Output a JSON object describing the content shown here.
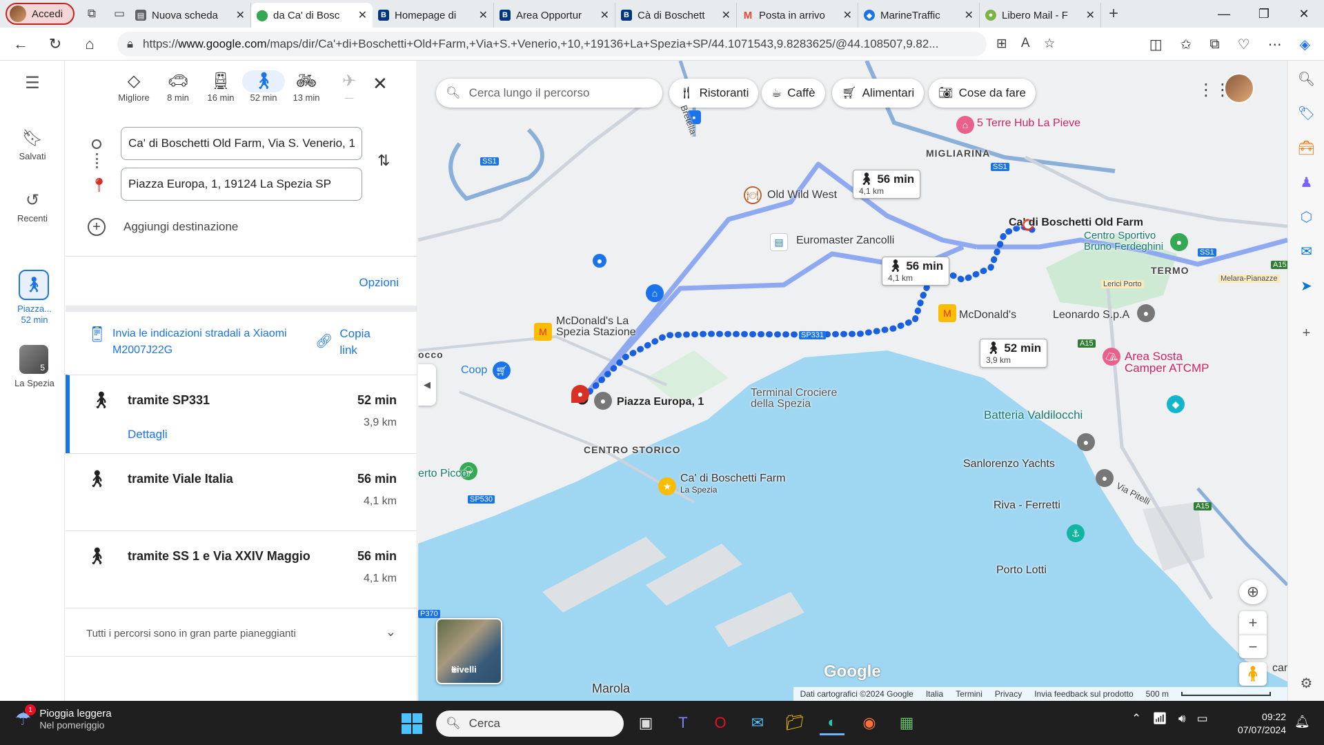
{
  "browser": {
    "profile_label": "Accedi",
    "tabs": [
      {
        "title": "Nuova scheda",
        "favicon": "newtab-icon",
        "color": "#5f6368"
      },
      {
        "title": "da Ca' di Bosc",
        "favicon": "maps-pin-icon",
        "color": "#34a853"
      },
      {
        "title": "Homepage di",
        "favicon": "booking-icon",
        "color": "#003580"
      },
      {
        "title": "Area Opportur",
        "favicon": "booking-icon",
        "color": "#003580"
      },
      {
        "title": "Cà di Boschett",
        "favicon": "booking-icon",
        "color": "#003580"
      },
      {
        "title": "Posta in arrivo",
        "favicon": "gmail-icon",
        "color": "#ea4335"
      },
      {
        "title": "MarineTraffic",
        "favicon": "marinetraffic-icon",
        "color": "#1a73e8"
      },
      {
        "title": "Libero Mail - F",
        "favicon": "libero-icon",
        "color": "#7cb342"
      }
    ],
    "url_prefix": "https://",
    "url_domain": "www.google.com",
    "url_rest": "/maps/dir/Ca'+di+Boschetti+Old+Farm,+Via+S.+Venerio,+10,+19136+La+Spezia+SP/44.1071543,9.8283625/@44.108507,9.82..."
  },
  "rail": {
    "saved": "Salvati",
    "recent": "Recenti",
    "walk_label_1": "Piazza...",
    "walk_label_2": "52 min",
    "thumb_badge": "5",
    "thumb_label": "La Spezia"
  },
  "directions": {
    "modes": [
      {
        "label": "Migliore",
        "icon": "diamond-route-icon"
      },
      {
        "label": "8 min",
        "icon": "car-icon"
      },
      {
        "label": "16 min",
        "icon": "train-icon"
      },
      {
        "label": "52 min",
        "icon": "walk-icon"
      },
      {
        "label": "13 min",
        "icon": "bike-icon"
      },
      {
        "label": "—",
        "icon": "plane-icon"
      }
    ],
    "origin": "Ca' di Boschetti Old Farm, Via S. Venerio, 1",
    "destination": "Piazza Europa, 1, 19124 La Spezia SP",
    "add_destination": "Aggiungi destinazione",
    "options": "Opzioni",
    "send_text": "Invia le indicazioni stradali a Xiaomi M2007J22G",
    "copy_link": "Copia link",
    "routes": [
      {
        "name": "tramite SP331",
        "time": "52 min",
        "distance": "3,9 km",
        "details": "Dettagli"
      },
      {
        "name": "tramite Viale Italia",
        "time": "56 min",
        "distance": "4,1 km"
      },
      {
        "name": "tramite SS 1 e Via XXIV Maggio",
        "time": "56 min",
        "distance": "4,1 km"
      }
    ],
    "footer": "Tutti i percorsi sono in gran parte pianeggianti"
  },
  "map": {
    "search_placeholder": "Cerca lungo il percorso",
    "chips": [
      "Ristoranti",
      "Caffè",
      "Alimentari",
      "Cose da fare"
    ],
    "labels": {
      "hub": "5 Terre Hub La Pieve",
      "migliarina": "MIGLIARINA",
      "old_wild_west": "Old Wild West",
      "euromaster": "Euromaster Zancolli",
      "origin": "Ca' di Boschetti Old Farm",
      "centro_ferdeghini_1": "Centro Sportivo",
      "centro_ferdeghini_2": "Bruno Ferdeghini",
      "termo": "TERMO",
      "lerici_porto": "Lerici Porto",
      "melara": "Melara-Pianazze",
      "mcd_stazione_1": "McDonald's La",
      "mcd_stazione_2": "Spezia Stazione",
      "mcd": "McDonald's",
      "leonardo": "Leonardo S.p.A",
      "area_sosta_1": "Area Sosta",
      "area_sosta_2": "Camper ATCMP",
      "occo": "occo",
      "coop": "Coop",
      "piazza_europa": "Piazza Europa, 1",
      "terminal_1": "Terminal Crociere",
      "terminal_2": "della Spezia",
      "batteria": "Batteria Valdilocchi",
      "centro_storico": "CENTRO STORICO",
      "farm_1": "Ca' di Boschetti Farm",
      "farm_2": "La Spezia",
      "sanlorenzo": "Sanlorenzo Yachts",
      "via_pitelli": "Via Pitelli",
      "riva": "Riva - Ferretti",
      "porto_lotti": "Porto Lotti",
      "erto_picco": "erto Picco",
      "marola": "Marola",
      "brettella": "Bretella",
      "ss1_a": "SS1",
      "ss1_b": "SS1",
      "ss1_c": "SS1",
      "sp331": "SP331",
      "sp530": "SP530",
      "a15_a": "A15",
      "a15_b": "A15",
      "a15_c": "A15",
      "p370": "P370",
      "can": "can"
    },
    "time_boxes": [
      {
        "time": "56 min",
        "dist": "4,1 km"
      },
      {
        "time": "56 min",
        "dist": "4,1 km"
      },
      {
        "time": "52 min",
        "dist": "3,9 km"
      }
    ],
    "layers": "Livelli",
    "google": "Google",
    "attribution": [
      "Dati cartografici ©2024 Google",
      "Italia",
      "Termini",
      "Privacy",
      "Invia feedback sul prodotto",
      "500 m"
    ]
  },
  "taskbar": {
    "weather_title": "Pioggia leggera",
    "weather_sub": "Nel pomeriggio",
    "weather_badge": "1",
    "search": "Cerca",
    "time": "09:22",
    "date": "07/07/2024"
  },
  "colors": {
    "accent": "#1a73e8",
    "route_active": "#1a5fe0",
    "route_alt": "#8fa9f0",
    "water": "#9fd6f2",
    "land": "#eef0f1"
  }
}
